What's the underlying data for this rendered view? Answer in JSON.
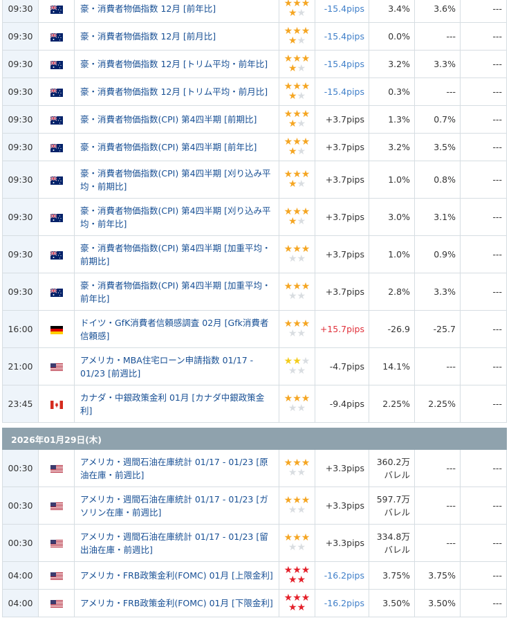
{
  "colors": {
    "star_on": "#f5a623",
    "star_off": "#d9dde1",
    "star_high": "#e4202a",
    "star_low": "#f3cc1c",
    "pips_negative": "#3f7fc9",
    "pips_positive_highlight": "#e0303a",
    "link": "#174f94",
    "date_header_bg": "#8fa2ad",
    "time_bg": "#eef4fa"
  },
  "rows_day1": [
    {
      "time": "09:30",
      "flag": "australia-flag-icon",
      "name": "豪・消費者物価指数 12月 [前年比]",
      "stars": 2,
      "star_color": "orange",
      "pips": "-15.4pips",
      "pips_type": "neg",
      "actual": "3.4%",
      "forecast": "3.6%",
      "result": "---",
      "rh": 1
    },
    {
      "time": "09:30",
      "flag": "australia-flag-icon",
      "name": "豪・消費者物価指数 12月 [前月比]",
      "stars": 2,
      "star_color": "orange",
      "pips": "-15.4pips",
      "pips_type": "neg",
      "actual": "0.0%",
      "forecast": "---",
      "result": "---",
      "rh": 1
    },
    {
      "time": "09:30",
      "flag": "australia-flag-icon",
      "name": "豪・消費者物価指数 12月 [トリム平均・前年比]",
      "stars": 2,
      "star_color": "orange",
      "pips": "-15.4pips",
      "pips_type": "neg",
      "actual": "3.2%",
      "forecast": "3.3%",
      "result": "---",
      "rh": 1
    },
    {
      "time": "09:30",
      "flag": "australia-flag-icon",
      "name": "豪・消費者物価指数 12月 [トリム平均・前月比]",
      "stars": 2,
      "star_color": "orange",
      "pips": "-15.4pips",
      "pips_type": "neg",
      "actual": "0.3%",
      "forecast": "---",
      "result": "---",
      "rh": 1
    },
    {
      "time": "09:30",
      "flag": "australia-flag-icon",
      "name": "豪・消費者物価指数(CPI) 第4四半期 [前期比]",
      "stars": 2,
      "star_color": "orange",
      "pips": "+3.7pips",
      "pips_type": "pos",
      "actual": "1.3%",
      "forecast": "0.7%",
      "result": "---",
      "rh": 1
    },
    {
      "time": "09:30",
      "flag": "australia-flag-icon",
      "name": "豪・消費者物価指数(CPI) 第4四半期 [前年比]",
      "stars": 2,
      "star_color": "orange",
      "pips": "+3.7pips",
      "pips_type": "pos",
      "actual": "3.2%",
      "forecast": "3.5%",
      "result": "---",
      "rh": 1
    },
    {
      "time": "09:30",
      "flag": "australia-flag-icon",
      "name": "豪・消費者物価指数(CPI) 第4四半期 [刈り込み平均・前期比]",
      "stars": 2,
      "star_color": "orange",
      "pips": "+3.7pips",
      "pips_type": "pos",
      "actual": "1.0%",
      "forecast": "0.8%",
      "result": "---",
      "rh": 2
    },
    {
      "time": "09:30",
      "flag": "australia-flag-icon",
      "name": "豪・消費者物価指数(CPI) 第4四半期 [刈り込み平均・前年比]",
      "stars": 2,
      "star_color": "orange",
      "pips": "+3.7pips",
      "pips_type": "pos",
      "actual": "3.0%",
      "forecast": "3.1%",
      "result": "---",
      "rh": 2
    },
    {
      "time": "09:30",
      "flag": "australia-flag-icon",
      "name": "豪・消費者物価指数(CPI) 第4四半期 [加重平均・前期比]",
      "stars": 1,
      "star_color": "orange",
      "pips": "+3.7pips",
      "pips_type": "pos",
      "actual": "1.0%",
      "forecast": "0.9%",
      "result": "---",
      "rh": 2
    },
    {
      "time": "09:30",
      "flag": "australia-flag-icon",
      "name": "豪・消費者物価指数(CPI) 第4四半期 [加重平均・前年比]",
      "stars": 1,
      "star_color": "orange",
      "pips": "+3.7pips",
      "pips_type": "pos",
      "actual": "2.8%",
      "forecast": "3.3%",
      "result": "---",
      "rh": 2
    },
    {
      "time": "16:00",
      "flag": "germany-flag-icon",
      "name": "ドイツ・GfK消費者信頼感調査 02月 [Gfk消費者信頼感]",
      "stars": 1,
      "star_color": "orange",
      "pips": "+15.7pips",
      "pips_type": "posred",
      "actual": "-26.9",
      "forecast": "-25.7",
      "result": "---",
      "rh": 2
    },
    {
      "time": "21:00",
      "flag": "usa-flag-icon",
      "name": "アメリカ・MBA住宅ローン申請指数 01/17 - 01/23 [前週比]",
      "stars": 0,
      "star_color": "yellow",
      "pips": "-4.7pips",
      "pips_type": "pos",
      "actual": "14.1%",
      "forecast": "---",
      "result": "---",
      "rh": 2
    },
    {
      "time": "23:45",
      "flag": "canada-flag-icon",
      "name": "カナダ・中銀政策金利 01月 [カナダ中銀政策金利]",
      "stars": 1,
      "star_color": "orange",
      "pips": "-9.4pips",
      "pips_type": "pos",
      "actual": "2.25%",
      "forecast": "2.25%",
      "result": "---",
      "rh": 2
    }
  ],
  "date_header": "2026年01月29日(木)",
  "rows_day2": [
    {
      "time": "00:30",
      "flag": "usa-flag-icon",
      "name": "アメリカ・週間石油在庫統計 01/17 - 01/23 [原油在庫・前週比]",
      "stars": 1,
      "star_color": "orange",
      "pips": "+3.3pips",
      "pips_type": "pos",
      "actual_l1": "360.2万",
      "actual_l2": "バレル",
      "forecast": "---",
      "result": "---",
      "rh": 2
    },
    {
      "time": "00:30",
      "flag": "usa-flag-icon",
      "name": "アメリカ・週間石油在庫統計 01/17 - 01/23 [ガソリン在庫・前週比]",
      "stars": 1,
      "star_color": "orange",
      "pips": "+3.3pips",
      "pips_type": "pos",
      "actual_l1": "597.7万",
      "actual_l2": "バレル",
      "forecast": "---",
      "result": "---",
      "rh": 2
    },
    {
      "time": "00:30",
      "flag": "usa-flag-icon",
      "name": "アメリカ・週間石油在庫統計 01/17 - 01/23 [留出油在庫・前週比]",
      "stars": 1,
      "star_color": "orange",
      "pips": "+3.3pips",
      "pips_type": "pos",
      "actual_l1": "334.8万",
      "actual_l2": "バレル",
      "forecast": "---",
      "result": "---",
      "rh": 2
    },
    {
      "time": "04:00",
      "flag": "usa-flag-icon",
      "name": "アメリカ・FRB政策金利(FOMC) 01月 [上限金利]",
      "stars": 3,
      "star_color": "red",
      "pips": "-16.2pips",
      "pips_type": "neg",
      "actual": "3.75%",
      "forecast": "3.75%",
      "result": "---",
      "rh": 1
    },
    {
      "time": "04:00",
      "flag": "usa-flag-icon",
      "name": "アメリカ・FRB政策金利(FOMC) 01月 [下限金利]",
      "stars": 3,
      "star_color": "red",
      "pips": "-16.2pips",
      "pips_type": "neg",
      "actual": "3.50%",
      "forecast": "3.50%",
      "result": "---",
      "rh": 1
    }
  ]
}
